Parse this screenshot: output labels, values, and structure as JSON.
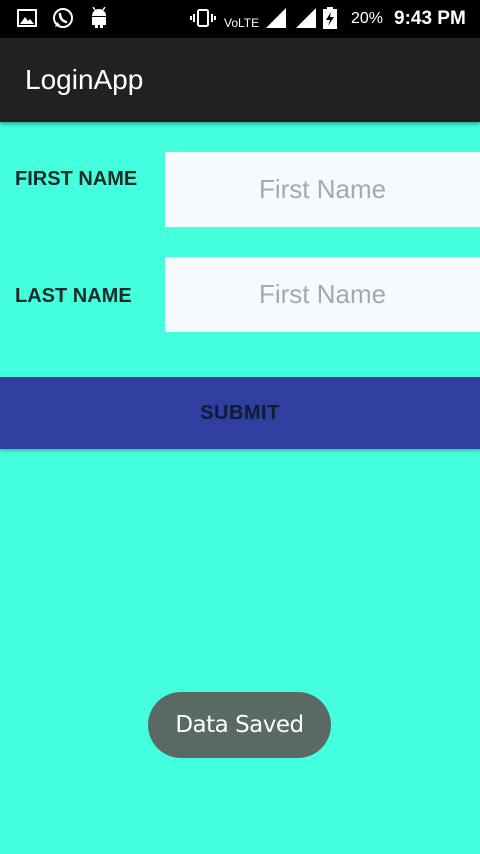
{
  "status_bar": {
    "left_icons": [
      "gallery-icon",
      "whatsapp-icon",
      "android-icon"
    ],
    "right_icons": [
      "vibrate-icon",
      "signal-icon",
      "signal-icon",
      "battery-charging-icon"
    ],
    "network": "VoLTE",
    "battery": "20%",
    "time": "9:43 PM"
  },
  "app_bar": {
    "title": "LoginApp"
  },
  "form": {
    "first_name_label": "FIRST NAME",
    "first_name_placeholder": "First Name",
    "first_name_value": "",
    "last_name_label": "LAST NAME",
    "last_name_placeholder": "First Name",
    "last_name_value": "",
    "submit_label": "SUBMIT"
  },
  "toast": {
    "message": "Data Saved"
  },
  "colors": {
    "background": "#44ffdd",
    "app_bar": "#212121",
    "status_bar": "#000000",
    "button": "#303f9f",
    "input": "#f5fbfd",
    "toast": "#586a63"
  }
}
